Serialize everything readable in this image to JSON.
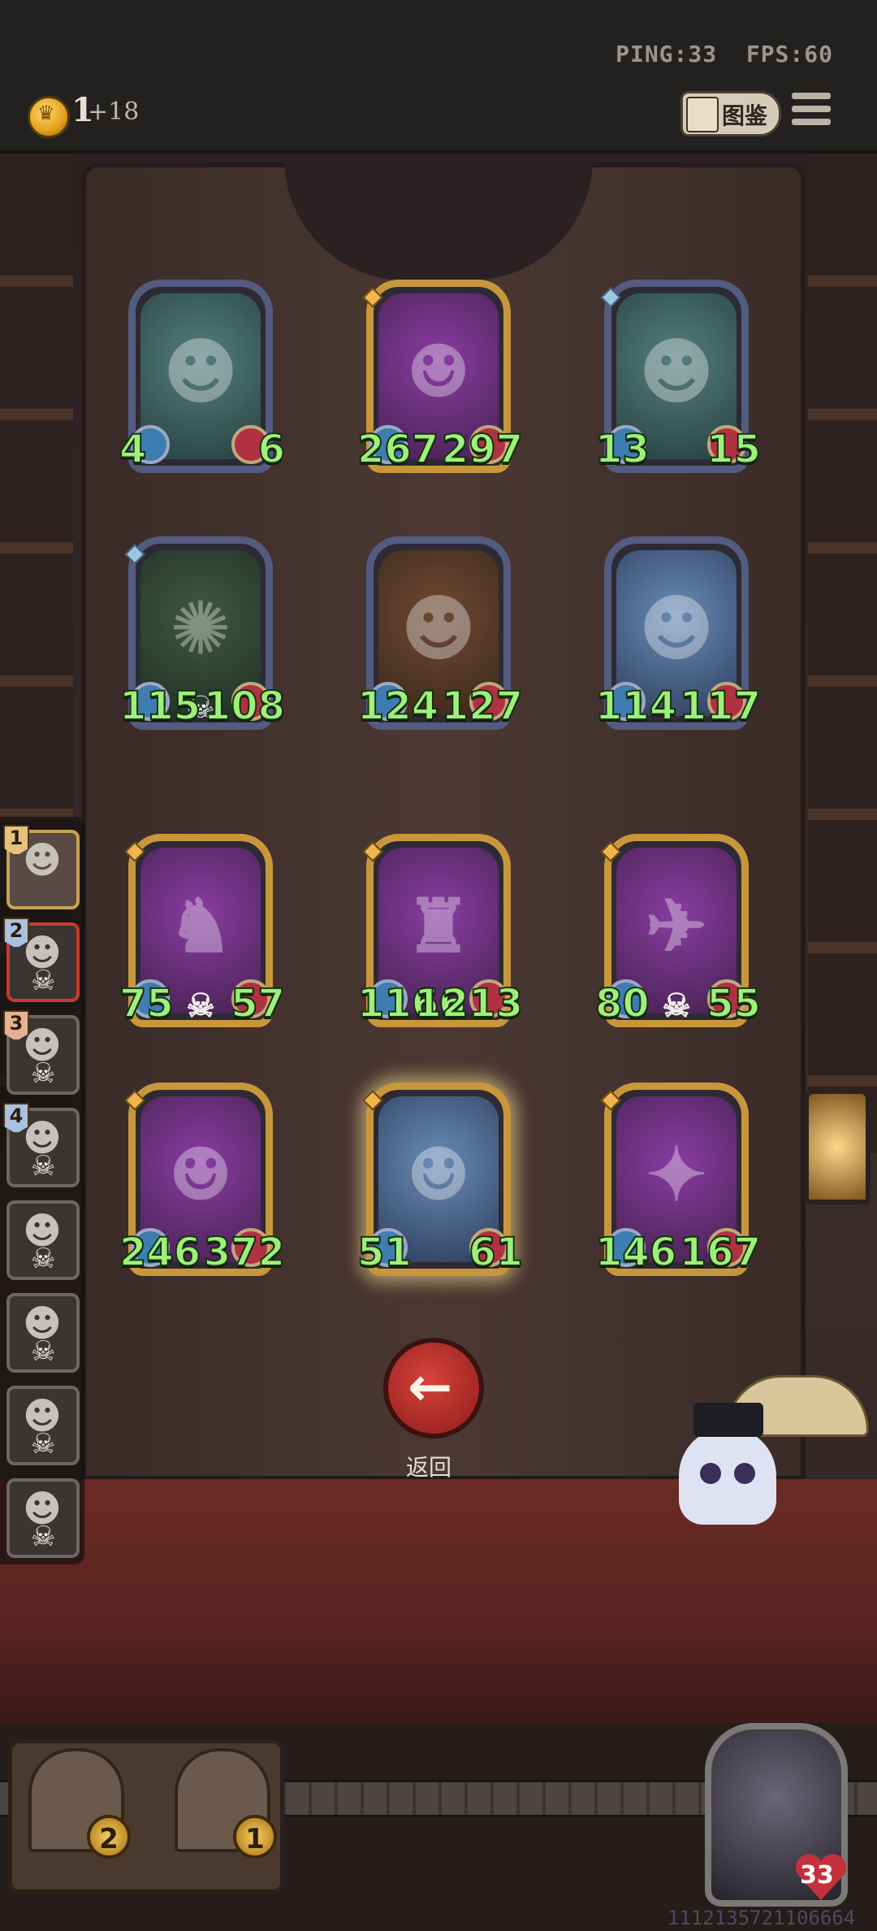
{
  "status": {
    "ping": "PING:33",
    "fps": "FPS:60"
  },
  "currency": {
    "amount": "1",
    "income": "+18"
  },
  "codex_label": "图鉴",
  "cards": [
    {
      "atk": "4",
      "hp": "6"
    },
    {
      "atk": "267",
      "hp": "297"
    },
    {
      "atk": "13",
      "hp": "15"
    },
    {
      "atk": "115",
      "hp": "108"
    },
    {
      "atk": "124",
      "hp": "127"
    },
    {
      "atk": "114",
      "hp": "117"
    },
    {
      "atk": "75",
      "hp": "57"
    },
    {
      "atk": "1166",
      "hp": "1213"
    },
    {
      "atk": "80",
      "hp": "55"
    },
    {
      "atk": "246",
      "hp": "372"
    },
    {
      "atk": "51",
      "hp": "61"
    },
    {
      "atk": "146",
      "hp": "167"
    }
  ],
  "queue": [
    {
      "rank": "1"
    },
    {
      "rank": "2"
    },
    {
      "rank": "3"
    },
    {
      "rank": "4"
    }
  ],
  "back_label": "返回",
  "hand": {
    "slot1": "2",
    "slot2": "1"
  },
  "player": {
    "health": "33",
    "id": "1112135721106664"
  }
}
